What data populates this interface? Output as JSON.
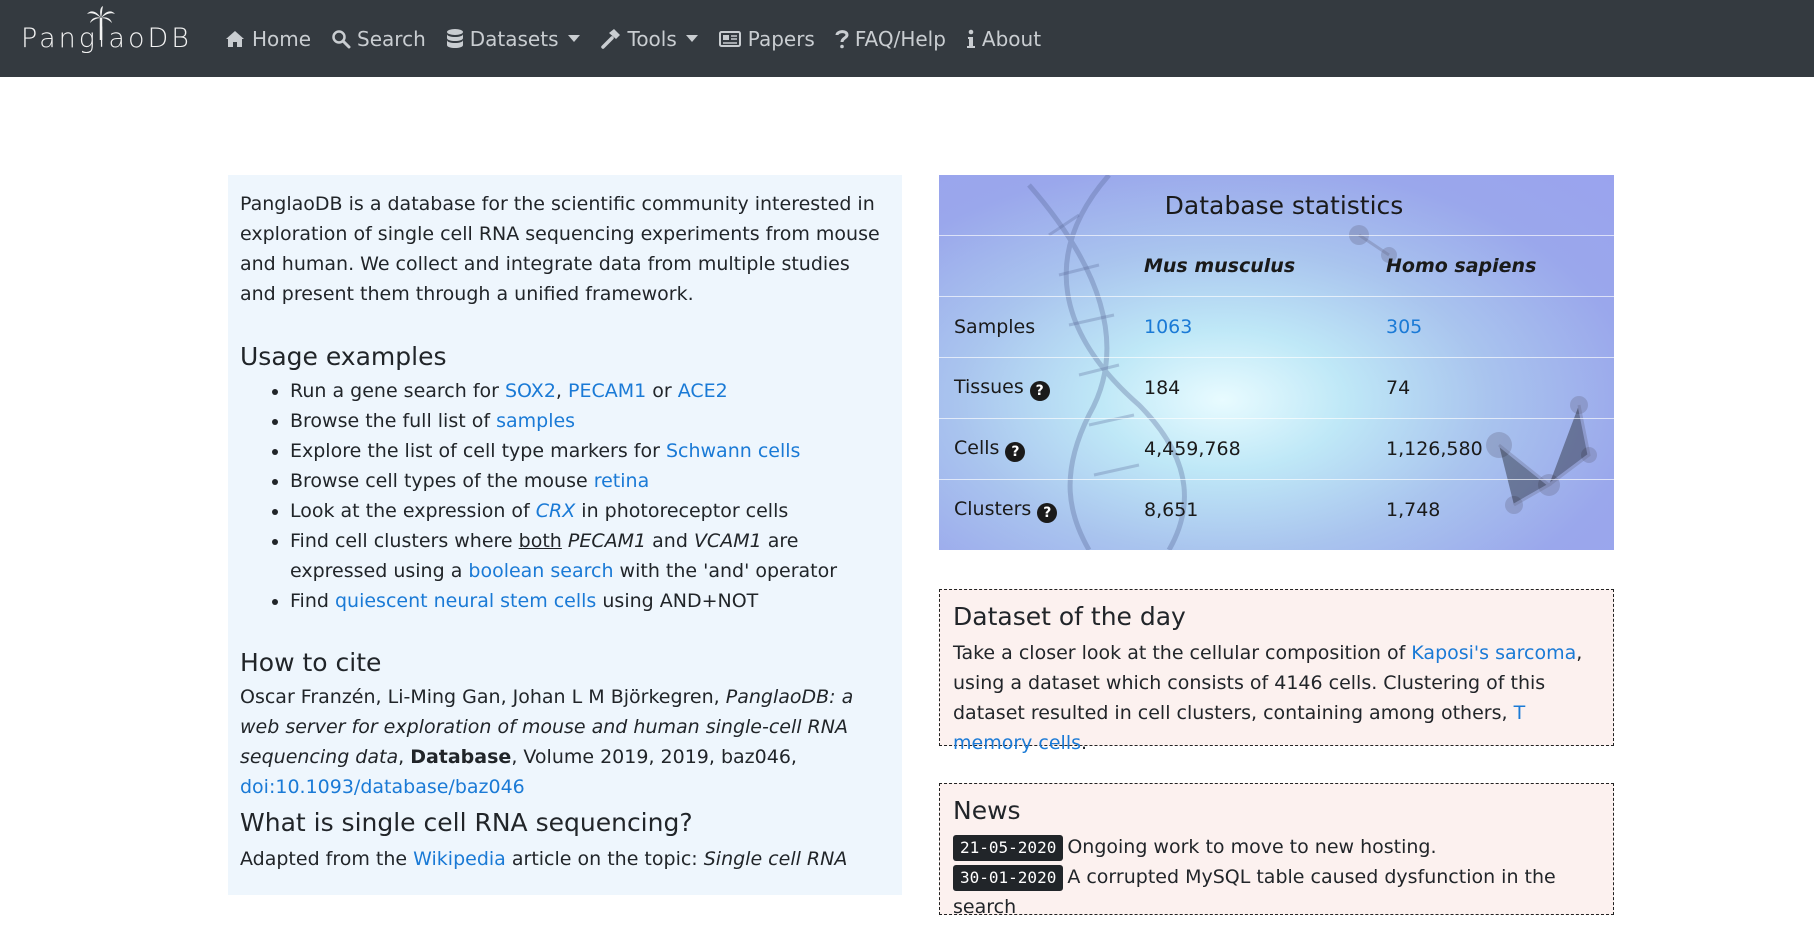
{
  "nav": {
    "brand": "PanglaoDB",
    "items": [
      {
        "label": "Home",
        "icon": "home-icon"
      },
      {
        "label": "Search",
        "icon": "search-icon"
      },
      {
        "label": "Datasets",
        "icon": "database-icon",
        "dropdown": true
      },
      {
        "label": "Tools",
        "icon": "hammer-icon",
        "dropdown": true
      },
      {
        "label": "Papers",
        "icon": "newspaper-icon"
      },
      {
        "label": "FAQ/Help",
        "icon": "question-icon"
      },
      {
        "label": "About",
        "icon": "info-icon"
      }
    ]
  },
  "intro": "PanglaoDB is a database for the scientific community interested in exploration of single cell RNA sequencing experiments from mouse and human. We collect and integrate data from multiple studies and present them through a unified framework.",
  "usage": {
    "heading": "Usage examples",
    "e1": {
      "pre": "Run a gene search for ",
      "l1": "SOX2",
      "sep1": ", ",
      "l2": "PECAM1",
      "sep2": " or ",
      "l3": "ACE2"
    },
    "e2": {
      "pre": "Browse the full list of ",
      "link": "samples"
    },
    "e3": {
      "pre": "Explore the list of cell type markers for ",
      "link": "Schwann cells"
    },
    "e4": {
      "pre": "Browse cell types of the mouse ",
      "link": "retina"
    },
    "e5": {
      "pre": "Look at the expression of ",
      "link": "CRX",
      "post": " in photoreceptor cells"
    },
    "e6": {
      "pre": "Find cell clusters where ",
      "u": "both",
      "g1": "PECAM1",
      "and": " and ",
      "g2": "VCAM1",
      "mid": " are expressed using a ",
      "link": "boolean search",
      "post": " with the 'and' operator"
    },
    "e7": {
      "pre": "Find ",
      "link": "quiescent neural stem cells",
      "post": " using AND+NOT"
    }
  },
  "cite": {
    "heading": "How to cite",
    "authors": "Oscar Franzén, Li-Ming Gan, Johan L M Björkegren, ",
    "title": "PanglaoDB: a web server for exploration of mouse and human single-cell RNA sequencing data",
    "comma": ", ",
    "journal": "Database",
    "rest": ", Volume 2019, 2019, baz046,",
    "doi": "doi:10.1093/database/baz046"
  },
  "scrna": {
    "heading": "What is single cell RNA sequencing?",
    "pre": "Adapted from the ",
    "link": "Wikipedia",
    "post": " article on the topic: ",
    "italic": "Single cell RNA"
  },
  "stats": {
    "title": "Database statistics",
    "species": [
      "Mus musculus",
      "Homo sapiens"
    ],
    "rows": [
      {
        "label": "Samples",
        "mouse": "1063",
        "human": "305"
      },
      {
        "label": "Tissues",
        "mouse": "184",
        "human": "74"
      },
      {
        "label": "Cells",
        "mouse": "4,459,768",
        "human": "1,126,580"
      },
      {
        "label": "Clusters",
        "mouse": "8,651",
        "human": "1,748"
      }
    ]
  },
  "dotd": {
    "heading": "Dataset of the day",
    "pre": "Take a closer look at the cellular composition of ",
    "link1": "Kaposi's sarcoma",
    "mid": ", using a dataset which consists of 4146 cells. Clustering of this dataset resulted in cell clusters, containing among others, ",
    "link2": "T memory cells",
    "post": "."
  },
  "news": {
    "heading": "News",
    "items": [
      {
        "date": "21-05-2020",
        "text": "Ongoing work to move to new hosting."
      },
      {
        "date": "30-01-2020",
        "text": "A corrupted MySQL table caused dysfunction in the search"
      }
    ]
  },
  "colors": {
    "navbar": "#343a40",
    "link": "#1a7ad6",
    "panel": "#eef6fd",
    "box": "#fcf1ef"
  }
}
